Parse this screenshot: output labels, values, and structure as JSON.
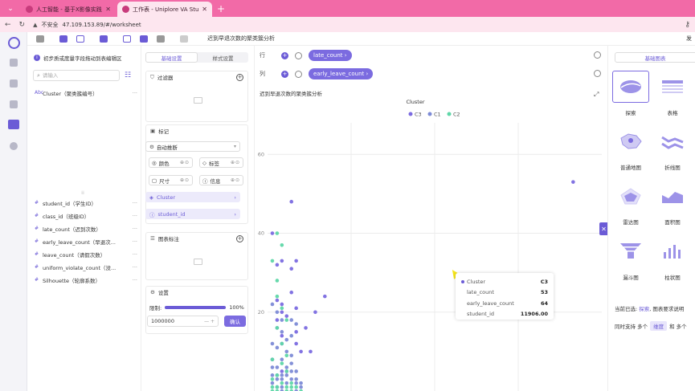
{
  "browser": {
    "tabs": [
      {
        "title": "人工智能 - 基于X影像实践科学平台",
        "active": false
      },
      {
        "title": "工作表 - Uniplore VA Studio",
        "active": true
      }
    ],
    "security": "不安全",
    "url": "47.109.153.89/#/worksheet"
  },
  "toolbar": {
    "title": "迟到早退次数的聚类簇分析",
    "right": "发"
  },
  "data_panel": {
    "notice": "初步质或度量字段拖动到表编辑区",
    "search_placeholder": "请输入",
    "dimensions": [
      {
        "type": "Abc",
        "name": "Cluster（聚类簇编号）"
      }
    ],
    "measures": [
      {
        "type": "#",
        "name": "student_id（学生ID）"
      },
      {
        "type": "#",
        "name": "class_id（班级ID）"
      },
      {
        "type": "#",
        "name": "late_count（迟到次数）"
      },
      {
        "type": "#",
        "name": "early_leave_count（早退次..."
      },
      {
        "type": "#",
        "name": "leave_count（请假次数）"
      },
      {
        "type": "#",
        "name": "uniform_violate_count（没..."
      },
      {
        "type": "#",
        "name": "Silhouette（轮廓系数）"
      }
    ],
    "more": "···",
    "splitter": "⁞⁞"
  },
  "config": {
    "tabs": [
      "基础设置",
      "样式设置"
    ],
    "filter": "过滤器",
    "marks": "标记",
    "mark_type": "自动推断",
    "mark_buttons": [
      "颜色",
      "标签",
      "尺寸",
      "信息"
    ],
    "mark_fields": [
      "Cluster",
      "student_id"
    ],
    "annotation": "图表标注",
    "settings": "设置",
    "limit_label": "限制:",
    "limit_value": "100%",
    "limit_fraction": 1.0,
    "limit_input": "1000000",
    "confirm": "确认"
  },
  "shelves": {
    "row_label": "行",
    "row_chip": "late_count ›",
    "col_label": "列",
    "col_chip": "early_leave_count ›"
  },
  "chart_title": "迟到早退次数的聚类簇分析",
  "chart_data": {
    "type": "scatter",
    "title": "迟到早退次数的聚类簇分析",
    "legend_title": "Cluster",
    "legend_position": "top-center",
    "xlabel": "",
    "ylabel": "",
    "ylim": [
      0,
      68
    ],
    "xlim": [
      0,
      70
    ],
    "yticks": [
      20,
      40,
      60
    ],
    "grid": true,
    "series": [
      {
        "name": "C3",
        "color": "#7b6be0",
        "points": [
          [
            64,
            53
          ],
          [
            1,
            40
          ],
          [
            6,
            21
          ],
          [
            10,
            20
          ],
          [
            5,
            25
          ],
          [
            12,
            24
          ],
          [
            3,
            22
          ],
          [
            2,
            23
          ],
          [
            3,
            14
          ],
          [
            3,
            12
          ],
          [
            6,
            15
          ],
          [
            6,
            12
          ],
          [
            7,
            10
          ],
          [
            9,
            10
          ],
          [
            8,
            16
          ],
          [
            2,
            18
          ],
          [
            4,
            19
          ],
          [
            3,
            20
          ],
          [
            5,
            31
          ],
          [
            2,
            32
          ],
          [
            6,
            33
          ],
          [
            3,
            33
          ],
          [
            5,
            48
          ],
          [
            3,
            5
          ],
          [
            4,
            5
          ]
        ]
      },
      {
        "name": "C1",
        "color": "#7d8bd6",
        "points": [
          [
            1,
            22
          ],
          [
            2,
            20
          ],
          [
            3,
            18
          ],
          [
            5,
            18
          ],
          [
            6,
            17
          ],
          [
            2,
            16
          ],
          [
            3,
            15
          ],
          [
            5,
            14
          ],
          [
            4,
            13
          ],
          [
            1,
            12
          ],
          [
            2,
            11
          ],
          [
            4,
            10
          ],
          [
            5,
            9
          ],
          [
            1,
            8
          ],
          [
            3,
            8
          ],
          [
            5,
            7
          ],
          [
            1,
            6
          ],
          [
            2,
            6
          ],
          [
            4,
            6
          ],
          [
            5,
            5
          ],
          [
            6,
            5
          ],
          [
            1,
            4
          ],
          [
            2,
            4
          ],
          [
            3,
            4
          ],
          [
            4,
            4
          ],
          [
            2,
            3
          ],
          [
            3,
            3
          ],
          [
            5,
            3
          ],
          [
            6,
            3
          ],
          [
            1,
            2
          ],
          [
            4,
            2
          ],
          [
            6,
            2
          ],
          [
            7,
            2
          ],
          [
            2,
            1
          ],
          [
            3,
            1
          ],
          [
            7,
            1
          ],
          [
            3,
            0
          ],
          [
            6,
            0
          ]
        ]
      },
      {
        "name": "C2",
        "color": "#5fd7a8",
        "points": [
          [
            2,
            40
          ],
          [
            3,
            37
          ],
          [
            1,
            33
          ],
          [
            2,
            28
          ],
          [
            2,
            24
          ],
          [
            3,
            21
          ],
          [
            4,
            18
          ],
          [
            2,
            16
          ],
          [
            3,
            12
          ],
          [
            4,
            9
          ],
          [
            1,
            8
          ],
          [
            3,
            7
          ],
          [
            4,
            5
          ],
          [
            2,
            4
          ],
          [
            1,
            3
          ],
          [
            3,
            2
          ],
          [
            5,
            2
          ],
          [
            1,
            1
          ],
          [
            2,
            1
          ],
          [
            4,
            1
          ],
          [
            5,
            1
          ],
          [
            6,
            1
          ],
          [
            1,
            0
          ],
          [
            2,
            0
          ],
          [
            4,
            0
          ],
          [
            5,
            0
          ],
          [
            7,
            0
          ]
        ]
      }
    ]
  },
  "tooltip": {
    "rows": [
      {
        "label": "Cluster",
        "value": "C3"
      },
      {
        "label": "late_count",
        "value": "53"
      },
      {
        "label": "early_leave_count",
        "value": "64"
      },
      {
        "label": "student_id",
        "value": "11906.00"
      }
    ]
  },
  "chart_types": {
    "header": "基础图表",
    "items": [
      "探索",
      "表格",
      "普通地图",
      "折线图",
      "雷达图",
      "面积图",
      "漏斗图",
      "柱状图"
    ],
    "selected": "探索",
    "current_prefix": "当前已选:",
    "current_value": "探索",
    "current_suffix": ", 图表要求说明",
    "support_prefix": "同时支持 多个",
    "support_tag": "维度",
    "support_suffix": "和 多个"
  },
  "colors": {
    "accent": "#6b5bd6",
    "tab_bar": "#f26aa7"
  }
}
